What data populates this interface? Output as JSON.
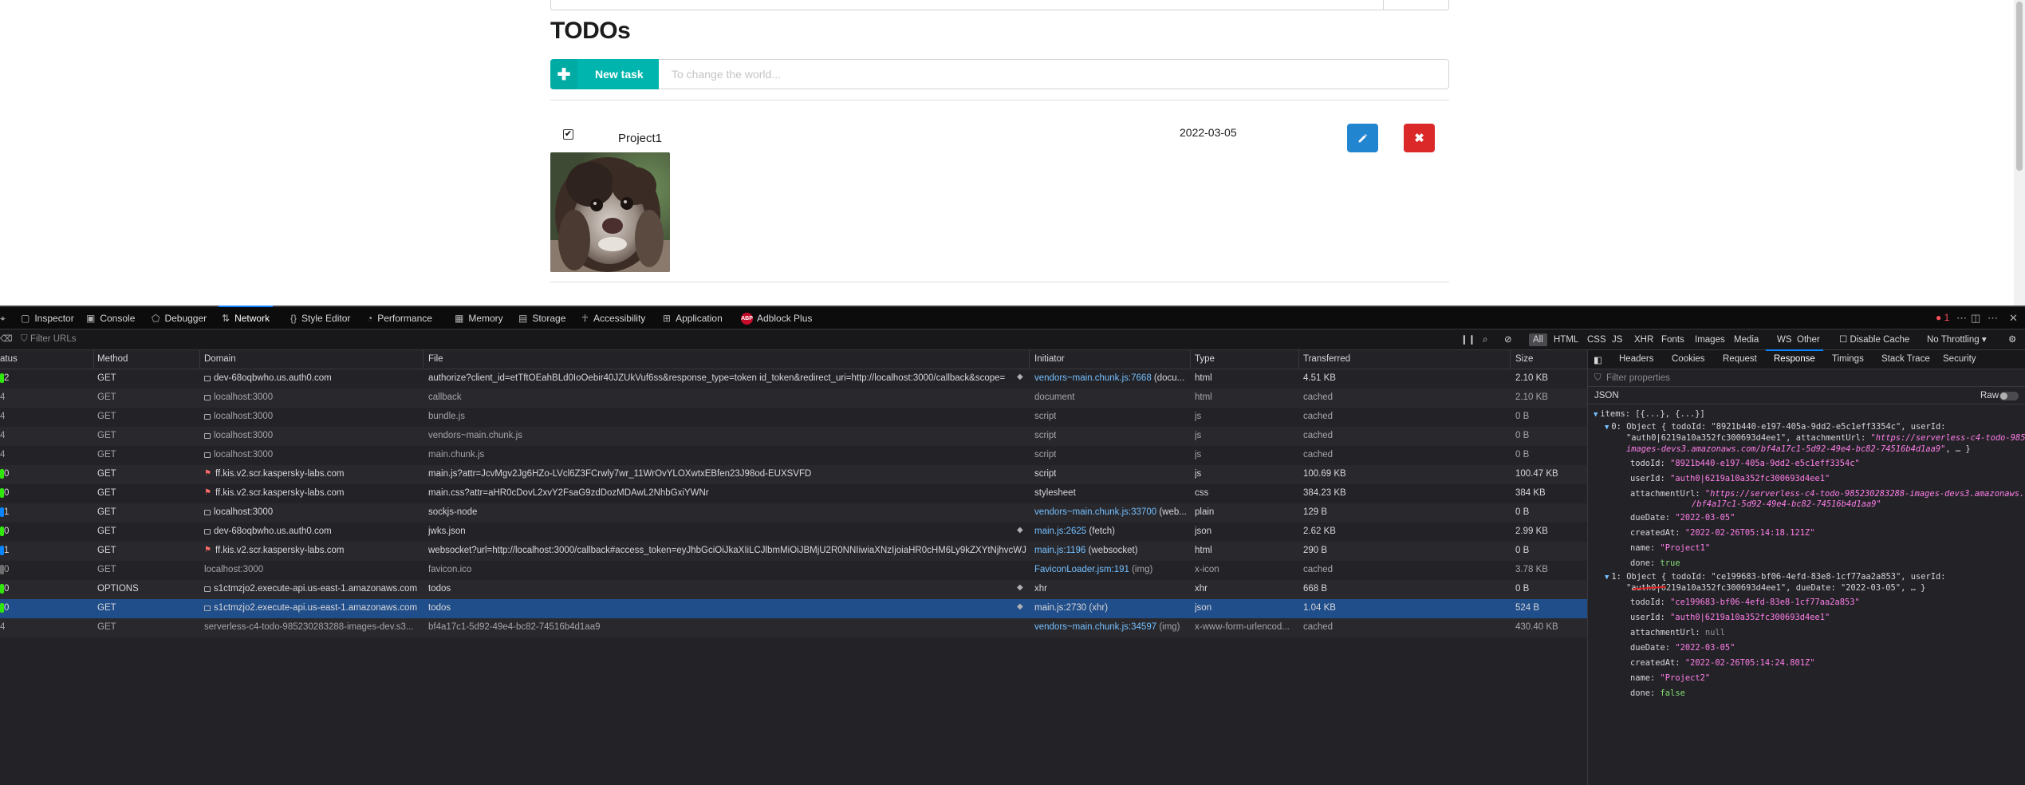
{
  "app": {
    "heading": "TODOs",
    "new_task_label": "New task",
    "new_task_placeholder": "To change the world...",
    "tasks": [
      {
        "name": "Project1",
        "due_date": "2022-03-05",
        "done": true,
        "has_image": true
      }
    ],
    "colors": {
      "teal": "#00b5ad",
      "blue": "#2185d0",
      "red": "#db2828"
    }
  },
  "devtools": {
    "tabs": [
      "Inspector",
      "Console",
      "Debugger",
      "Network",
      "Style Editor",
      "Performance",
      "Memory",
      "Storage",
      "Accessibility",
      "Application",
      "Adblock Plus"
    ],
    "active_tab": "Network",
    "error_count": "1",
    "filter_placeholder": "Filter URLs",
    "filter_types": [
      "All",
      "HTML",
      "CSS",
      "JS",
      "XHR",
      "Fonts",
      "Images",
      "Media",
      "WS",
      "Other"
    ],
    "disable_cache_label": "Disable Cache",
    "throttling_label": "No Throttling",
    "columns": [
      "atus",
      "Method",
      "Domain",
      "File",
      "Initiator",
      "Type",
      "Transferred",
      "Size"
    ],
    "requests": [
      {
        "status": "2",
        "method": "GET",
        "domain": "dev-68oqbwho.us.auth0.com",
        "file": "authorize?client_id=etTftOEahBLd0IoOebir40JZUkVuf6ss&response_type=token id_token&redirect_uri=http://localhost:3000/callback&scope=",
        "initiator": "vendors~main.chunk.js:7668",
        "initiator_suffix": " (docu...",
        "type": "html",
        "transferred": "4.51 KB",
        "size": "2.10 KB"
      },
      {
        "status": "4",
        "method": "GET",
        "domain": "localhost:3000",
        "file": "callback",
        "initiator": "document",
        "type": "html",
        "transferred": "cached",
        "size": "2.10 KB"
      },
      {
        "status": "4",
        "method": "GET",
        "domain": "localhost:3000",
        "file": "bundle.js",
        "initiator": "script",
        "type": "js",
        "transferred": "cached",
        "size": "0 B"
      },
      {
        "status": "4",
        "method": "GET",
        "domain": "localhost:3000",
        "file": "vendors~main.chunk.js",
        "initiator": "script",
        "type": "js",
        "transferred": "cached",
        "size": "0 B"
      },
      {
        "status": "4",
        "method": "GET",
        "domain": "localhost:3000",
        "file": "main.chunk.js",
        "initiator": "script",
        "type": "js",
        "transferred": "cached",
        "size": "0 B"
      },
      {
        "status": "0",
        "method": "GET",
        "domain": "ff.kis.v2.scr.kaspersky-labs.com",
        "file": "main.js?attr=JcvMgv2Jg6HZo-LVcl6Z3FCrwly7wr_11WrOvYLOXwtxEBfen23J98od-EUXSVFD",
        "initiator": "script",
        "type": "js",
        "transferred": "100.69 KB",
        "size": "100.47 KB"
      },
      {
        "status": "0",
        "method": "GET",
        "domain": "ff.kis.v2.scr.kaspersky-labs.com",
        "file": "main.css?attr=aHR0cDovL2xvY2FsaG9zdDozMDAwL2NhbGxiYWNr",
        "initiator": "stylesheet",
        "type": "css",
        "transferred": "384.23 KB",
        "size": "384 KB"
      },
      {
        "status": "1",
        "method": "GET",
        "domain": "localhost:3000",
        "file": "sockjs-node",
        "initiator": "vendors~main.chunk.js:33700",
        "initiator_suffix": " (web...",
        "type": "plain",
        "transferred": "129 B",
        "size": "0 B"
      },
      {
        "status": "0",
        "method": "GET",
        "domain": "dev-68oqbwho.us.auth0.com",
        "file": "jwks.json",
        "initiator": "main.js:2625",
        "initiator_suffix": " (fetch)",
        "type": "json",
        "transferred": "2.62 KB",
        "size": "2.99 KB"
      },
      {
        "status": "1",
        "method": "GET",
        "domain": "ff.kis.v2.scr.kaspersky-labs.com",
        "file": "websocket?url=http://localhost:3000/callback#access_token=eyJhbGciOiJkaXIiLCJlbmMiOiJBMjU2R0NNIiwiaXNzIjoiaHR0cHM6Ly9kZXYtNjhvcWJ3aG8",
        "initiator": "main.js:1196",
        "initiator_suffix": " (websocket)",
        "type": "html",
        "transferred": "290 B",
        "size": "0 B"
      },
      {
        "status": "0",
        "method": "GET",
        "domain": "localhost:3000",
        "file": "favicon.ico",
        "initiator": "FaviconLoader.jsm:191",
        "initiator_suffix": " (img)",
        "type": "x-icon",
        "transferred": "cached",
        "size": "3.78 KB"
      },
      {
        "status": "0",
        "method": "OPTIONS",
        "domain": "s1ctmzjo2.execute-api.us-east-1.amazonaws.com",
        "file": "todos",
        "initiator": "xhr",
        "type": "xhr",
        "transferred": "668 B",
        "size": "0 B"
      },
      {
        "status": "0",
        "method": "GET",
        "domain": "s1ctmzjo2.execute-api.us-east-1.amazonaws.com",
        "file": "todos",
        "initiator": "main.js:2730",
        "initiator_suffix": " (xhr)",
        "type": "json",
        "transferred": "1.04 KB",
        "size": "524 B"
      },
      {
        "status": "4",
        "method": "GET",
        "domain": "serverless-c4-todo-985230283288-images-dev.s3...",
        "file": "bf4a17c1-5d92-49e4-bc82-74516b4d1aa9",
        "initiator": "vendors~main.chunk.js:34597",
        "initiator_suffix": " (img)",
        "type": "x-www-form-urlencod...",
        "transferred": "cached",
        "size": "430.40 KB"
      }
    ],
    "sidebar": {
      "tabs": [
        "Headers",
        "Cookies",
        "Request",
        "Response",
        "Timings",
        "Stack Trace",
        "Security"
      ],
      "active_tab": "Response",
      "filter_placeholder": "Filter properties",
      "json_label": "JSON",
      "raw_label": "Raw",
      "items_line": "items: [{...}, {...}]",
      "obj0": {
        "summary_a": "0: Object { todoId: \"8921b440-e197-405a-9dd2-e5c1eff3354c\", userId:",
        "summary_b": "\"auth0|6219a10a352fc300693d4ee1\", attachmentUrl: ",
        "summary_c": "\"https://serverless-c4-todo-985230283288-",
        "summary_d": "images-devs3.amazonaws.com/bf4a17c1-5d92-49e4-bc82-74516b4d1aa9\"",
        "summary_e": ", … }",
        "todoId": "\"8921b440-e197-405a-9dd2-e5c1eff3354c\"",
        "userId": "\"auth0|6219a10a352fc300693d4ee1\"",
        "attachmentUrl_a": "\"https://serverless-c4-todo-985230283288-images-devs3.amazonaws.com",
        "attachmentUrl_b": "/bf4a17c1-5d92-49e4-bc82-74516b4d1aa9\"",
        "dueDate": "\"2022-03-05\"",
        "createdAt": "\"2022-02-26T05:14:18.121Z\"",
        "name": "\"Project1\"",
        "done": "true"
      },
      "obj1": {
        "summary_a": "1: Object { todoId: \"ce199683-bf06-4efd-83e8-1cf77aa2a853\", userId:",
        "summary_b": "\"auth0|6219a10a352fc300693d4ee1\", dueDate: \"2022-03-05\", … }",
        "todoId": "\"ce199683-bf06-4efd-83e8-1cf77aa2a853\"",
        "userId": "\"auth0|6219a10a352fc300693d4ee1\"",
        "attachmentUrl": "null",
        "dueDate": "\"2022-03-05\"",
        "createdAt": "\"2022-02-26T05:14:24.801Z\"",
        "name": "\"Project2\"",
        "done": "false"
      },
      "keys": {
        "todoId": "todoId:",
        "userId": "userId:",
        "attachmentUrl": "attachmentUrl:",
        "dueDate": "dueDate:",
        "createdAt": "createdAt:",
        "name": "name:",
        "done": "done:"
      }
    }
  }
}
